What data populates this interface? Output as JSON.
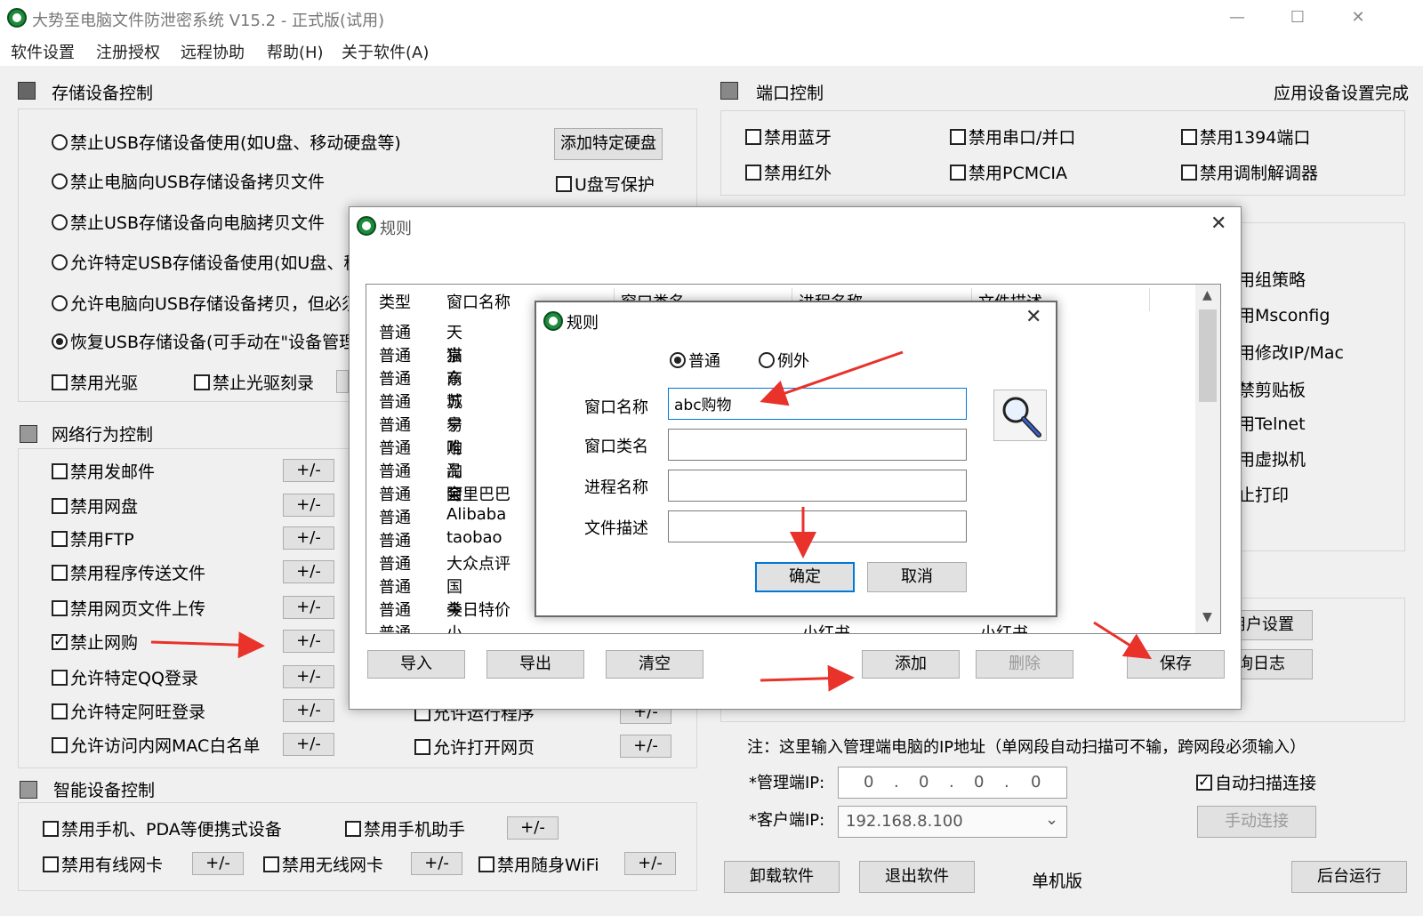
{
  "window": {
    "title": "大势至电脑文件防泄密系统 V15.2 - 正式版(试用)",
    "minimize": "—",
    "maximize": "☐",
    "close": "✕"
  },
  "menu": [
    "软件设置",
    "注册授权",
    "远程协助",
    "帮助(H)",
    "关于软件(A)"
  ],
  "storage": {
    "title": "存储设备控制",
    "options": [
      {
        "label": "禁止USB存储设备使用(如U盘、移动硬盘等)",
        "selected": false
      },
      {
        "label": "禁止电脑向USB存储设备拷贝文件",
        "selected": false
      },
      {
        "label": "禁止USB存储设备向电脑拷贝文件",
        "selected": false
      },
      {
        "label": "允许特定USB存储设备使用(如U盘、移",
        "selected": false
      },
      {
        "label": "允许电脑向USB存储设备拷贝，但必须",
        "selected": false
      },
      {
        "label": "恢复USB存储设备(可手动在\"设备管理",
        "selected": true
      }
    ],
    "add_disk_button": "添加特定硬盘",
    "usb_write_protect": "U盘写保护",
    "disable_optical": "禁用光驱",
    "disable_burn": "禁止光驱刻录"
  },
  "ports": {
    "title": "端口控制",
    "status": "应用设备设置完成",
    "items": [
      {
        "label": "禁用蓝牙",
        "checked": false
      },
      {
        "label": "禁用串口/并口",
        "checked": false
      },
      {
        "label": "禁用1394端口",
        "checked": false
      },
      {
        "label": "禁用红外",
        "checked": false
      },
      {
        "label": "禁用PCMCIA",
        "checked": false
      },
      {
        "label": "禁用调制解调器",
        "checked": false
      }
    ]
  },
  "right_partial": [
    "用组策略",
    "用Msconfig",
    "用修改IP/Mac",
    "禁剪贴板",
    "用Telnet",
    "用虚拟机",
    "止打印"
  ],
  "right_buttons": {
    "user_settings": "用户设置",
    "log": "询日志"
  },
  "network": {
    "title": "网络行为控制",
    "plusminus": "+/-",
    "items": [
      {
        "label": "禁用发邮件",
        "checked": false
      },
      {
        "label": "禁用网盘",
        "checked": false
      },
      {
        "label": "禁用FTP",
        "checked": false
      },
      {
        "label": "禁用程序传送文件",
        "checked": false
      },
      {
        "label": "禁用网页文件上传",
        "checked": false
      },
      {
        "label": "禁止网购",
        "checked": true
      },
      {
        "label": "允许特定QQ登录",
        "checked": false
      },
      {
        "label": "允许特定阿旺登录",
        "checked": false
      },
      {
        "label": "允许访问内网MAC白名单",
        "checked": false
      }
    ],
    "allow_run": "允许运行程序",
    "allow_web": "允许打开网页"
  },
  "smart": {
    "title": "智能设备控制",
    "items": [
      "禁用手机、PDA等便携式设备",
      "禁用手机助手",
      "禁用有线网卡",
      "禁用无线网卡",
      "禁用随身WiFi"
    ]
  },
  "connection": {
    "note": "注：这里输入管理端电脑的IP地址（单网段自动扫描可不输，跨网段必须输入）",
    "admin_ip_label": "*管理端IP:",
    "admin_ip": [
      "0",
      "0",
      "0",
      "0"
    ],
    "client_ip_label": "*客户端IP:",
    "client_ip": "192.168.8.100",
    "auto_scan": "自动扫描连接",
    "manual_connect": "手动连接"
  },
  "bottom": {
    "uninstall": "卸载软件",
    "exit": "退出软件",
    "mode": "单机版",
    "background": "后台运行"
  },
  "rules_dialog": {
    "title": "规则",
    "columns": [
      "类型",
      "窗口名称",
      "窗口类名",
      "进程名称",
      "文件描述"
    ],
    "rows": [
      {
        "type": "普通",
        "name": "天猫"
      },
      {
        "type": "普通",
        "name": "京东"
      },
      {
        "type": "普通",
        "name": "商城"
      },
      {
        "type": "普通",
        "name": "苏宁"
      },
      {
        "type": "普通",
        "name": "易购"
      },
      {
        "type": "普通",
        "name": "唯品会"
      },
      {
        "type": "普通",
        "name": "淘宝"
      },
      {
        "type": "普通",
        "name": "阿里巴巴"
      },
      {
        "type": "普通",
        "name": "Alibaba"
      },
      {
        "type": "普通",
        "name": "taobao"
      },
      {
        "type": "普通",
        "name": "大众点评"
      },
      {
        "type": "普通",
        "name": "国美"
      },
      {
        "type": "普通",
        "name": "今日特价"
      },
      {
        "type": "普通",
        "name": "小红书"
      }
    ],
    "partial_cells": [
      "小红书",
      "小红书"
    ],
    "buttons": {
      "import": "导入",
      "export": "导出",
      "clear": "清空",
      "add": "添加",
      "delete": "删除",
      "save": "保存"
    }
  },
  "rule_editor": {
    "title": "规则",
    "type_normal": "普通",
    "type_exception": "例外",
    "window_name_label": "窗口名称",
    "window_name_value": "abc购物",
    "class_name_label": "窗口类名",
    "class_name_value": "",
    "process_label": "进程名称",
    "process_value": "",
    "desc_label": "文件描述",
    "desc_value": "",
    "ok": "确定",
    "cancel": "取消"
  },
  "colors": {
    "accent": "#0078d7",
    "arrow": "#e8322a",
    "icon_green": "#1e8a3c"
  }
}
